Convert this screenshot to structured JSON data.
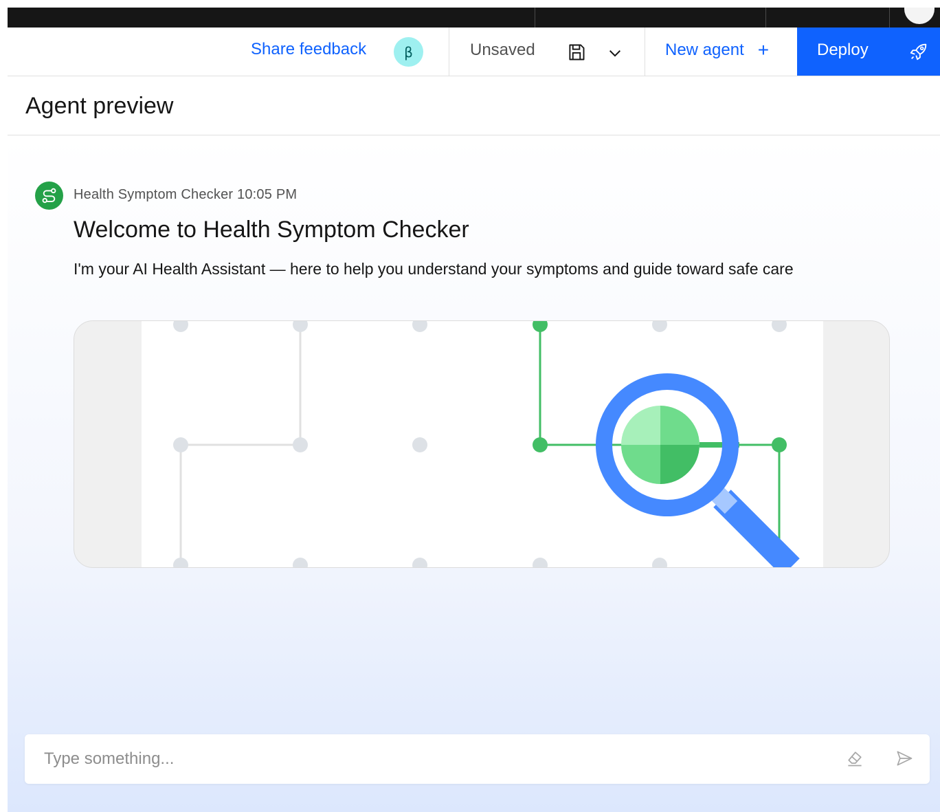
{
  "toolbar": {
    "share_feedback": "Share feedback",
    "beta_badge": "β",
    "save_status": "Unsaved",
    "new_agent": "New agent",
    "new_agent_icon": "+",
    "deploy": "Deploy"
  },
  "preview": {
    "title": "Agent preview"
  },
  "message": {
    "agent_name": "Health Symptom Checker",
    "time": "10:05 PM",
    "title": "Welcome to Health Symptom Checker",
    "body": "I'm your AI Health Assistant — here to help you understand your symptoms and guide toward safe care"
  },
  "input": {
    "placeholder": "Type something..."
  },
  "colors": {
    "accent": "#0f62fe",
    "agent_avatar": "#24a148",
    "beta_badge": "#9ef0f0",
    "illustration_green": "#42be65",
    "illustration_blue": "#4589ff"
  }
}
